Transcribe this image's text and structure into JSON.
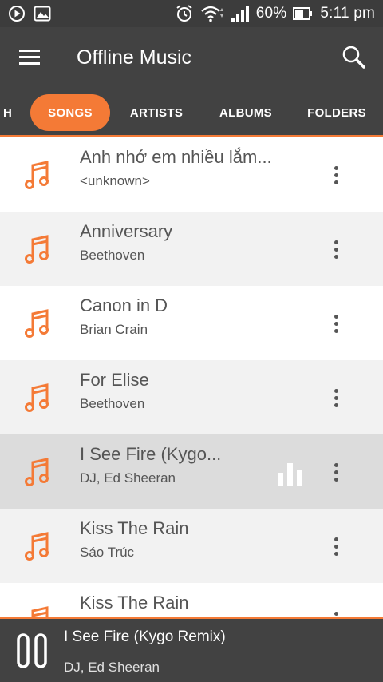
{
  "colors": {
    "accent": "#f47a36",
    "toolbar": "#424242",
    "status_bar": "#3c3c3c",
    "text": "#555555"
  },
  "status_bar": {
    "left_icons": [
      "play-circle-icon",
      "image-icon"
    ],
    "right_icons": [
      "alarm-icon",
      "wifi-icon",
      "signal-icon",
      "battery-icon"
    ],
    "battery": "60%",
    "time": "5:11 pm"
  },
  "toolbar": {
    "menu_icon": "hamburger-menu-icon",
    "title": "Offline Music",
    "search_icon": "search-icon"
  },
  "tabs": {
    "partial": "H",
    "items": [
      {
        "label": "SONGS",
        "active": true
      },
      {
        "label": "ARTISTS",
        "active": false
      },
      {
        "label": "ALBUMS",
        "active": false
      },
      {
        "label": "FOLDERS",
        "active": false
      }
    ]
  },
  "songs": [
    {
      "title": "Anh nhớ em nhiều lắm...",
      "artist": "<unknown>",
      "playing": false
    },
    {
      "title": "Anniversary",
      "artist": "Beethoven",
      "playing": false
    },
    {
      "title": "Canon in D",
      "artist": "Brian Crain",
      "playing": false
    },
    {
      "title": "For Elise",
      "artist": "Beethoven",
      "playing": false
    },
    {
      "title": "I See Fire (Kygo...",
      "artist": "DJ, Ed Sheeran",
      "playing": true
    },
    {
      "title": "Kiss The Rain",
      "artist": "Sáo Trúc",
      "playing": false
    },
    {
      "title": "Kiss The Rain",
      "artist": "",
      "playing": false
    }
  ],
  "now_playing": {
    "title": "I See Fire (Kygo Remix)",
    "artist": "DJ, Ed Sheeran",
    "control_icon": "pause-icon"
  }
}
